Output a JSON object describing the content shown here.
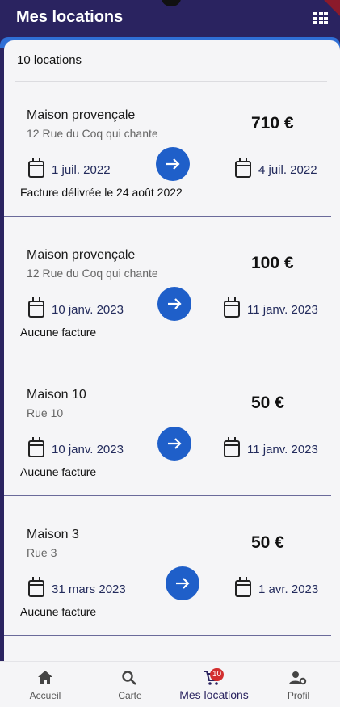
{
  "app": {
    "title": "Mes locations"
  },
  "list": {
    "count_label": "10 locations"
  },
  "rentals": [
    {
      "name": "Maison provençale",
      "address": "12 Rue du Coq qui chante",
      "price": "710 €",
      "start": "1 juil. 2022",
      "end": "4 juil. 2022",
      "invoice": "Facture délivrée le 24 août 2022"
    },
    {
      "name": "Maison provençale",
      "address": "12 Rue du Coq qui chante",
      "price": "100 €",
      "start": "10 janv. 2023",
      "end": "11 janv. 2023",
      "invoice": "Aucune facture"
    },
    {
      "name": "Maison 10",
      "address": "Rue 10",
      "price": "50 €",
      "start": "10 janv. 2023",
      "end": "11 janv. 2023",
      "invoice": "Aucune facture"
    },
    {
      "name": "Maison 3",
      "address": "Rue 3",
      "price": "50 €",
      "start": "31 mars 2023",
      "end": "1 avr. 2023",
      "invoice": "Aucune facture"
    }
  ],
  "nav": {
    "items": [
      {
        "label": "Accueil",
        "icon": "home-icon"
      },
      {
        "label": "Carte",
        "icon": "search-icon"
      },
      {
        "label": "Mes locations",
        "icon": "cart-icon",
        "badge": "10",
        "active": true
      },
      {
        "label": "Profil",
        "icon": "user-settings-icon"
      }
    ]
  },
  "colors": {
    "appbar": "#2a2360",
    "accent": "#1f5fc9",
    "badge": "#d32f2f"
  }
}
